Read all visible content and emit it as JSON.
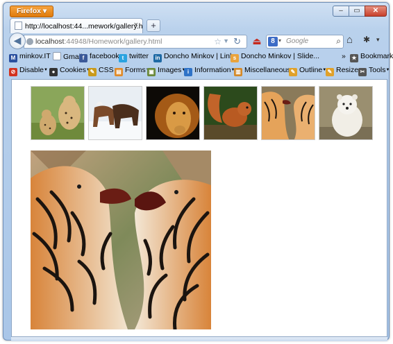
{
  "window": {
    "app_button": "Firefox ▾",
    "min_label": "–",
    "max_label": "▭",
    "close_label": "✕"
  },
  "tab": {
    "title": "http://localhost:44...mework/gallery.html",
    "close": "×",
    "new_tab": "+"
  },
  "navbar": {
    "back": "◀",
    "url_host": "localhost",
    "url_rest": ":44948/Homework/gallery.html",
    "search_engine_letter": "8",
    "search_placeholder": "Google"
  },
  "bookmarks": [
    {
      "label": "minkov.IT",
      "icon": "m-icon",
      "color": "#2a4f9e",
      "glyph": "M"
    },
    {
      "label": "Gmail",
      "icon": "page-icon",
      "color": "#ffffff",
      "glyph": ""
    },
    {
      "label": "facebook",
      "icon": "facebook-icon",
      "color": "#3b5998",
      "glyph": "f"
    },
    {
      "label": "twitter",
      "icon": "twitter-icon",
      "color": "#2aa3e0",
      "glyph": "t"
    },
    {
      "label": "Doncho Minkov | Link...",
      "icon": "linkedin-icon",
      "color": "#1f6aa5",
      "glyph": "in"
    },
    {
      "label": "Doncho Minkov | Slide...",
      "icon": "slideshare-icon",
      "color": "#e9a33c",
      "glyph": "s"
    }
  ],
  "bookmarks_overflow": "»",
  "bookmarks_menu": "Bookmarks",
  "webdev": [
    {
      "label": "Disable",
      "icon": "no-icon",
      "color": "#d2321f",
      "glyph": "⊘"
    },
    {
      "label": "Cookies",
      "icon": "user-icon",
      "color": "#333333",
      "glyph": "●"
    },
    {
      "label": "CSS",
      "icon": "pencil-icon",
      "color": "#c99a1a",
      "glyph": "✎"
    },
    {
      "label": "Forms",
      "icon": "form-icon",
      "color": "#e08b2a",
      "glyph": "▤"
    },
    {
      "label": "Images",
      "icon": "image-icon",
      "color": "#6b8a3c",
      "glyph": "▣"
    },
    {
      "label": "Information",
      "icon": "info-icon",
      "color": "#2f73c7",
      "glyph": "i"
    },
    {
      "label": "Miscellaneous",
      "icon": "misc-icon",
      "color": "#d48a2a",
      "glyph": "▥"
    },
    {
      "label": "Outline",
      "icon": "outline-icon",
      "color": "#e0a12a",
      "glyph": "✎"
    },
    {
      "label": "Resize",
      "icon": "resize-icon",
      "color": "#e0a12a",
      "glyph": "✎"
    },
    {
      "label": "Tools",
      "icon": "tools-icon",
      "color": "#555555",
      "glyph": "✂"
    }
  ],
  "gallery": {
    "thumbnails": [
      {
        "subject": "cheetahs"
      },
      {
        "subject": "horses-in-snow"
      },
      {
        "subject": "lion"
      },
      {
        "subject": "squirrel"
      },
      {
        "subject": "tigers"
      },
      {
        "subject": "polar-bear-cub"
      }
    ],
    "selected": "tigers"
  }
}
